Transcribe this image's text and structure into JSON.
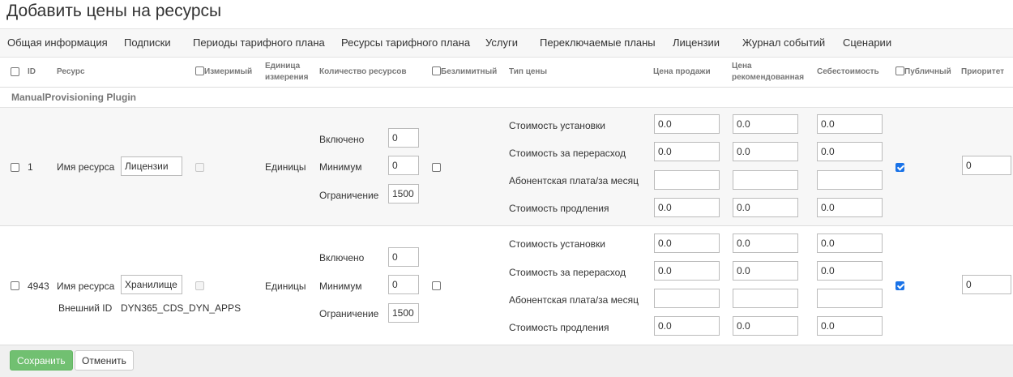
{
  "page": {
    "title": "Добавить цены на ресурсы"
  },
  "tabs": [
    "Общая информация",
    "Подписки",
    "Периоды тарифного плана",
    "Ресурсы тарифного плана",
    "Услуги",
    "Переключаемые планы",
    "Лицензии",
    "Журнал событий",
    "Сценарии"
  ],
  "columns": {
    "id": "ID",
    "resource": "Ресурс",
    "measurable": "Измеримый",
    "unit_line1": "Единица",
    "unit_line2": "измерения",
    "quantity": "Количество ресурсов",
    "unlimited": "Безлимитный",
    "price_type": "Тип цены",
    "sale_price": "Цена продажи",
    "rec_line1": "Цена",
    "rec_line2": "рекомендованная",
    "cost": "Себестоимость",
    "public": "Публичный",
    "priority": "Приоритет"
  },
  "group": {
    "name": "ManualProvisioning Plugin"
  },
  "rows": [
    {
      "id": "1",
      "resource_label": "Имя ресурса",
      "resource_name": "Лицензии",
      "unit": "Единицы",
      "qty_labels": [
        "Включено",
        "Минимум",
        "Ограничение"
      ],
      "qty_values": [
        "0",
        "0",
        "1500"
      ],
      "price_types": [
        "Стоимость установки",
        "Стоимость за перерасход",
        "Абонентская плата/за месяц",
        "Стоимость продления"
      ],
      "sale": [
        "0.0",
        "0.0",
        "",
        "0.0"
      ],
      "recommended": [
        "0.0",
        "0.0",
        "",
        "0.0"
      ],
      "cost": [
        "0.0",
        "0.0",
        "",
        "0.0"
      ],
      "public": true,
      "priority": "0"
    },
    {
      "id": "4943",
      "resource_label": "Имя ресурса",
      "resource_name": "Хранилище",
      "external_id_label": "Внешний ID",
      "external_id": "DYN365_CDS_DYN_APPS",
      "unit": "Единицы",
      "qty_labels": [
        "Включено",
        "Минимум",
        "Ограничение"
      ],
      "qty_values": [
        "0",
        "0",
        "1500"
      ],
      "price_types": [
        "Стоимость установки",
        "Стоимость за перерасход",
        "Абонентская плата/за месяц",
        "Стоимость продления"
      ],
      "sale": [
        "0.0",
        "0.0",
        "",
        "0.0"
      ],
      "recommended": [
        "0.0",
        "0.0",
        "",
        "0.0"
      ],
      "cost": [
        "0.0",
        "0.0",
        "",
        "0.0"
      ],
      "public": true,
      "priority": "0"
    }
  ],
  "footer": {
    "save": "Сохранить",
    "cancel": "Отменить"
  }
}
